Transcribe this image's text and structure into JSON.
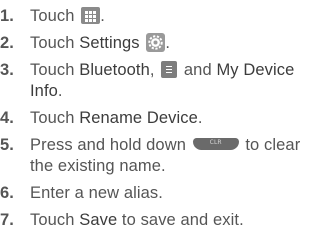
{
  "steps": [
    {
      "number": "1.",
      "text": "Touch",
      "icon": "apps-grid-icon",
      "tail": "."
    },
    {
      "number": "2.",
      "text": "Touch",
      "label": "Settings",
      "icon": "settings-gear-icon",
      "tail": "."
    },
    {
      "number": "3.",
      "text": "Touch",
      "label": "Bluetooth",
      "sep": ",",
      "icon": "menu-icon",
      "and": "and",
      "label2": "My Device Info",
      "tail": "."
    },
    {
      "number": "4.",
      "text": "Touch",
      "label": "Rename Device",
      "tail": "."
    },
    {
      "number": "5.",
      "text": "Press and hold down",
      "icon": "clear-key-icon",
      "key_label": "CLR",
      "text2": "to clear the existing name."
    },
    {
      "number": "6.",
      "text": "Enter a new alias."
    },
    {
      "number": "7.",
      "text": "Touch",
      "label": "Save",
      "text2": "to save and exit."
    }
  ],
  "colors": {
    "text": "#555555",
    "emphasis": "#3c3c3c",
    "icon": "#8a8a8a"
  }
}
